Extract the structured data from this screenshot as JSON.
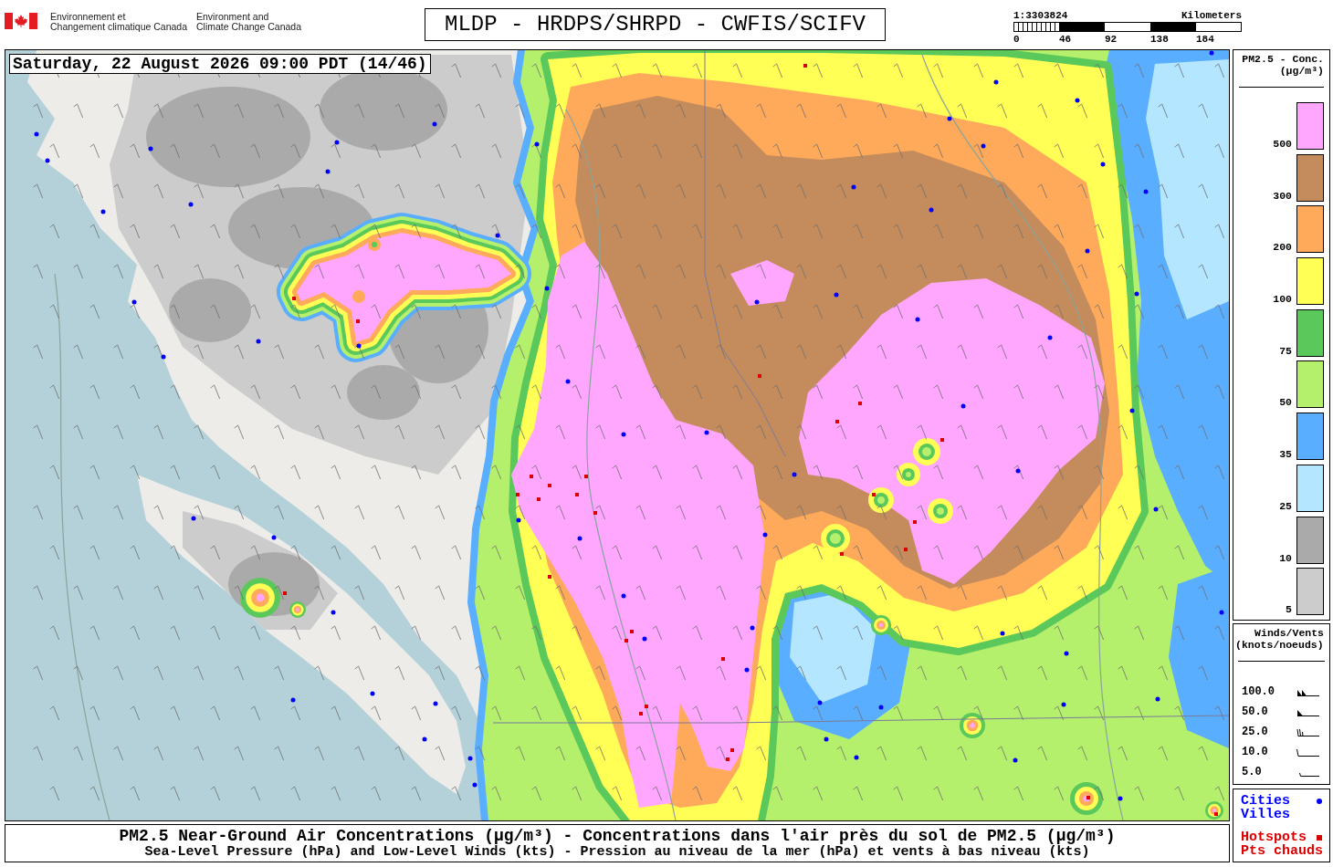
{
  "header": {
    "agency": [
      {
        "lines": [
          "Environnement et",
          "Changement climatique Canada"
        ]
      },
      {
        "lines": [
          "Environment and",
          "Climate Change Canada"
        ]
      }
    ],
    "title": "MLDP - HRDPS/SHRPD - CWFIS/SCIFV",
    "scale": {
      "ratio": "1:3303824",
      "unit": "Kilometers",
      "ticks": [
        "0",
        "46",
        "92",
        "138",
        "184"
      ]
    }
  },
  "map": {
    "valid_time": "Saturday, 22 August 2026 09:00 PDT (14/46)"
  },
  "legend": {
    "title": "PM2.5 - Conc.",
    "unit": "(µg/m³)",
    "items": [
      {
        "label": "500",
        "color": "#ffa6ff"
      },
      {
        "label": "300",
        "color": "#c48c5c"
      },
      {
        "label": "200",
        "color": "#ffaa5a"
      },
      {
        "label": "100",
        "color": "#ffff55"
      },
      {
        "label": "75",
        "color": "#5ac85a"
      },
      {
        "label": "50",
        "color": "#b4f06c"
      },
      {
        "label": "35",
        "color": "#5aaeff"
      },
      {
        "label": "25",
        "color": "#b4e6ff"
      },
      {
        "label": "10",
        "color": "#aaaaaa"
      },
      {
        "label": "5",
        "color": "#cccccc"
      }
    ]
  },
  "wind_legend": {
    "title": "Winds/Vents",
    "unit": "(knots/noeuds)",
    "items": [
      {
        "label": "100.0",
        "kind": "pennants"
      },
      {
        "label": "50.0",
        "kind": "pennant"
      },
      {
        "label": "25.0",
        "kind": "barbs"
      },
      {
        "label": "10.0",
        "kind": "barb"
      },
      {
        "label": "5.0",
        "kind": "halfbarb"
      }
    ]
  },
  "markers": [
    {
      "labels": [
        "Cities",
        "Villes"
      ],
      "kind": "dot",
      "color": "#0000ff"
    },
    {
      "labels": [
        "Hotspots",
        "Pts chauds"
      ],
      "kind": "square",
      "color": "#dd0000"
    }
  ],
  "caption": {
    "title": "PM2.5 Near-Ground Air Concentrations (µg/m³) - Concentrations dans l'air près du sol de PM2.5 (µg/m³)",
    "subtitle": "Sea-Level Pressure (hPa) and Low-Level Winds (kts) - Pression au niveau de la mer (hPa) et vents à bas niveau (kts)"
  }
}
